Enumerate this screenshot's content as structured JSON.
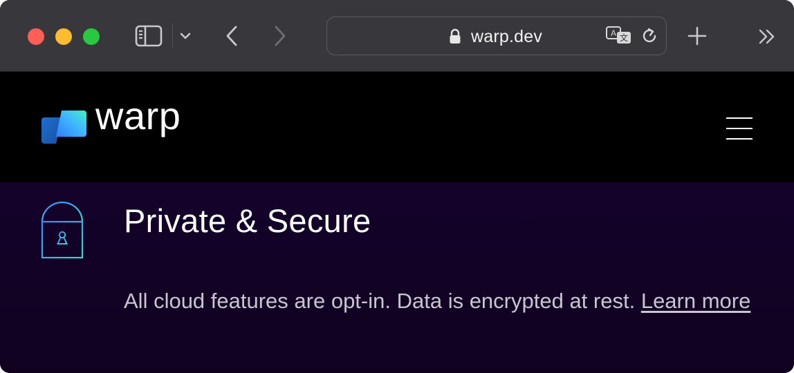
{
  "browser": {
    "url": "warp.dev",
    "icons": {
      "sidebar": "sidebar-icon",
      "tab_overview": "chevron-down-icon",
      "back": "back-arrow-icon",
      "forward": "forward-arrow-icon",
      "lock": "lock-icon",
      "translate": "translate-icon",
      "reload": "reload-icon",
      "new_tab": "plus-icon",
      "more": "double-chevron-right-icon"
    }
  },
  "site": {
    "logo_text": "warp",
    "menu_icon": "hamburger-menu-icon"
  },
  "feature": {
    "icon": "padlock-icon",
    "title": "Private & Secure",
    "description": "All cloud features are opt-in. Data is encrypted at rest. ",
    "link_text": "Learn more"
  },
  "colors": {
    "toolbar_bg": "#38373c",
    "page_header_bg": "#000000",
    "section_bg": "#14022b",
    "accent_blue": "#3aa0ff",
    "accent_teal": "#38e2c0"
  }
}
